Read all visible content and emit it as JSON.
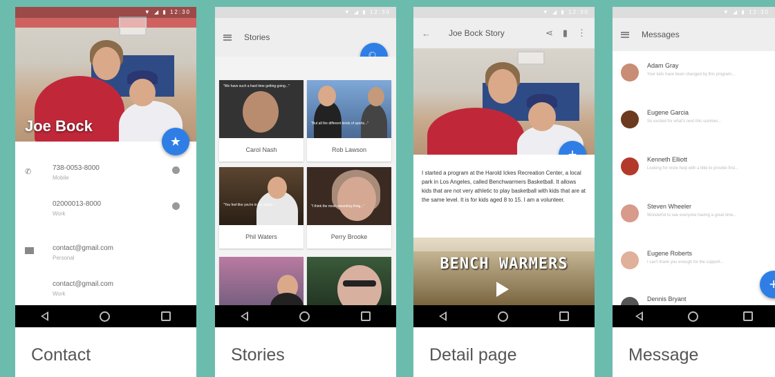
{
  "contact": {
    "name": "Joe Bock",
    "rows": [
      {
        "value": "738-0053-8000",
        "label": "Mobile"
      },
      {
        "value": "02000013-8000",
        "label": "Work"
      },
      {
        "value": "contact@gmail.com",
        "label": "Personal"
      },
      {
        "value": "contact@gmail.com",
        "label": "Work"
      }
    ],
    "caption": "Contact"
  },
  "stories": {
    "title": "Stories",
    "cards": [
      {
        "name": "Carol Nash",
        "quote": "\"We have such a hard time getting going...\""
      },
      {
        "name": "Rob Lawson",
        "quote": "\"But all the different kinds of sports...\""
      },
      {
        "name": "Phil Waters",
        "quote": "\"You feel like you're in the game...\""
      },
      {
        "name": "Perry Brooke",
        "quote": "\"I think the most rewarding thing...\""
      },
      {
        "name": "",
        "quote": ""
      },
      {
        "name": "",
        "quote": ""
      }
    ],
    "caption": "Stories"
  },
  "detail": {
    "title": "Joe Bock Story",
    "body": "I started a program at the Harold Ickes Recreation Center, a local park in Los Angeles, called Benchwarmers Basketball. It allows kids that are not very athletic to play basketball with kids that are at the same level. It is for kids aged 8 to 15. I am a volunteer.",
    "video_title": "BENCH WARMERS",
    "caption": "Detail page"
  },
  "messages": {
    "title": "Message",
    "caption": "Message",
    "items": [
      {
        "name": "Adam Gray",
        "preview": "Your kids have been changed by this program...",
        "color": "#c98c74"
      },
      {
        "name": "Eugene Garcia",
        "preview": "So excited for what's next this summer...",
        "color": "#6b3a1f"
      },
      {
        "name": "Kenneth Elliott",
        "preview": "Looking for more help with a little to provide first...",
        "color": "#b33a2a"
      },
      {
        "name": "Steven Wheeler",
        "preview": "Wonderful to see everyone having a great time...",
        "color": "#d89a8a"
      },
      {
        "name": "Eugene Roberts",
        "preview": "I can't thank you enough for the support...",
        "color": "#e0b09a"
      },
      {
        "name": "Dennis Bryant",
        "preview": "",
        "color": "#555555"
      }
    ]
  },
  "status": "▼ ◢ ▮ 12:30",
  "colors": {
    "accent": "#2f7ee6",
    "background": "#6cbcae"
  }
}
